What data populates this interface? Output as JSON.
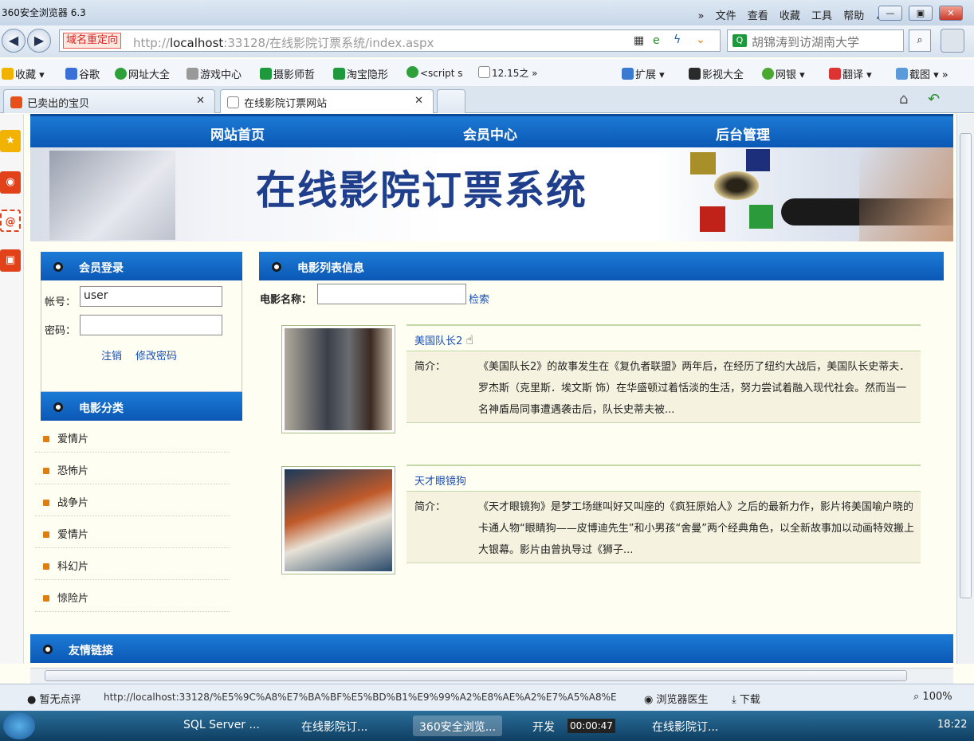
{
  "browser": {
    "title": "360安全浏览器 6.3",
    "menus": [
      "文件",
      "查看",
      "收藏",
      "工具",
      "帮助"
    ],
    "redirect_badge": "域名重定向",
    "url_host": "localhost",
    "url_prefix": "http://",
    "url_rest": ":33128/在线影院订票系统/index.aspx",
    "search_text": "胡锦涛到访湖南大学",
    "bookmarks": [
      "收藏",
      "谷歌",
      "网址大全",
      "游戏中心",
      "摄影师哲",
      "淘宝隐形",
      "<script s",
      "12.15之",
      "扩展",
      "影视大全",
      "网银",
      "翻译",
      "截图"
    ],
    "tabs": [
      {
        "label": "已卖出的宝贝"
      },
      {
        "label": "在线影院订票网站"
      }
    ]
  },
  "page": {
    "nav": [
      "网站首页",
      "会员中心",
      "后台管理"
    ],
    "banner_title": "在线影院订票系统",
    "login": {
      "header": "会员登录",
      "account_label": "帐号：",
      "account_value": "user",
      "password_label": "密码：",
      "logout": "注销",
      "change_password": "修改密码"
    },
    "categories": {
      "header": "电影分类",
      "items": [
        "爱情片",
        "恐怖片",
        "战争片",
        "爱情片",
        "科幻片",
        "惊险片"
      ]
    },
    "movies": {
      "header": "电影列表信息",
      "search_label": "电影名称：",
      "search_button": "检索",
      "desc_label": "简介：",
      "items": [
        {
          "title": "美国队长2",
          "desc": "《美国队长2》的故事发生在《复仇者联盟》两年后，在经历了纽约大战后，美国队长史蒂夫．罗杰斯（克里斯．埃文斯 饰）在华盛顿过着恬淡的生活，努力尝试着融入现代社会。然而当一名神盾局同事遭遇袭击后，队长史蒂夫被..."
        },
        {
          "title": "天才眼镜狗",
          "desc": "《天才眼镜狗》是梦工场继叫好又叫座的《疯狂原始人》之后的最新力作，影片将美国喻户晓的卡通人物“眼睛狗——皮博迪先生”和小男孩“舍曼”两个经典角色，以全新故事加以动画特效搬上大银幕。影片由曾执导过《狮子..."
        }
      ]
    },
    "links_header": "友情链接"
  },
  "status": {
    "rating": "暂无点评",
    "url": "http://localhost:33128/%E5%9C%A8%E7%BA%BF%E5%BD%B1%E9%99%A2%E8%AE%A2%E7%A5%A8%E",
    "doctor": "浏览器医生",
    "download": "下载",
    "zoom": "100%"
  },
  "taskbar": {
    "items": [
      "SQL Server ...",
      "在线影院订...",
      "360安全浏览...",
      "开发",
      "在线影院订..."
    ],
    "recording_time": "00:00:47",
    "clock": "18:22"
  },
  "colors": {
    "nav_blue": "#0a58b5",
    "banner_title": "#1f3f8c",
    "link": "#1a4fb4"
  }
}
